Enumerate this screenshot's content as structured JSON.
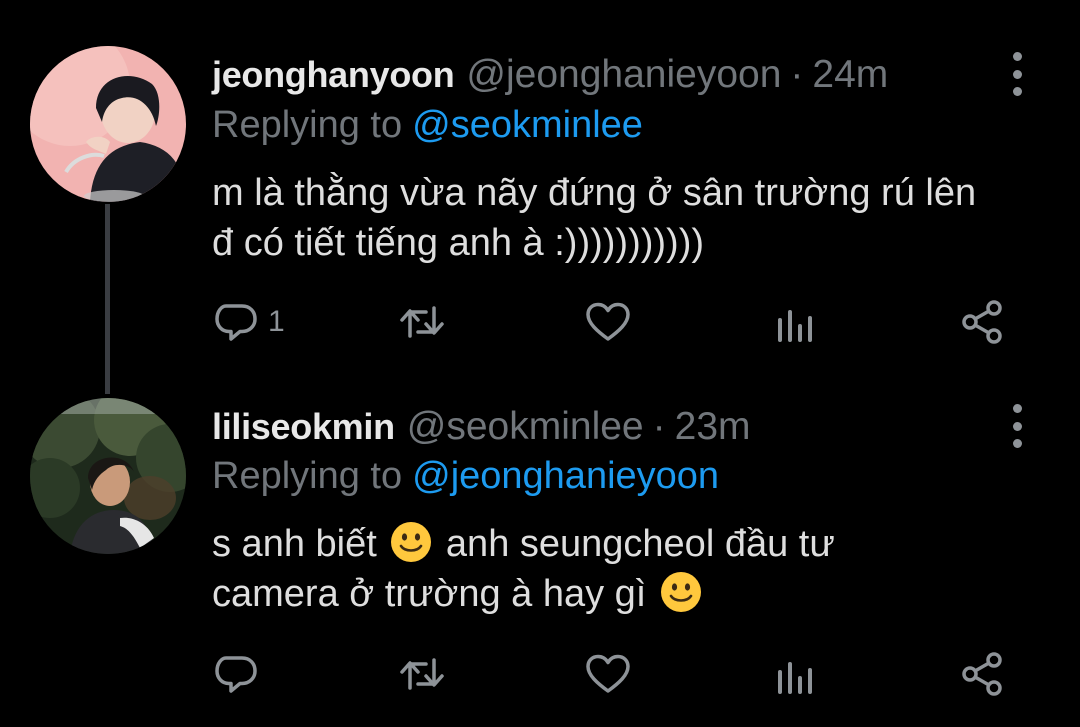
{
  "thread": [
    {
      "display_name": "jeonghanyoon",
      "handle": "@jeonghanieyoon",
      "separator": "·",
      "time": "24m",
      "replying_label": "Replying to",
      "replying_handle": "@seokminlee",
      "text_line_1": "m là thằng vừa nãy đứng ở sân trường rú lên",
      "text_line_2": "đ có tiết tiếng anh à :)))))))))))",
      "reply_count": "1",
      "avatar": "avatar-photo"
    },
    {
      "display_name": "liliseokmin",
      "handle": "@seokminlee",
      "separator": "·",
      "time": "23m",
      "replying_label": "Replying to",
      "replying_handle": "@jeonghanieyoon",
      "text_part_1": "s anh biết",
      "text_part_2": "anh seungcheol đầu tư",
      "text_part_3": "camera ở trường à hay gì",
      "reply_count": "",
      "avatar": "avatar-photo"
    }
  ],
  "icons": {
    "reply": "comment-bubble-icon",
    "retweet": "retweet-icon",
    "like": "heart-icon",
    "stats": "analytics-bars-icon",
    "share": "share-icon",
    "more": "vertical-dots-icon",
    "emoji": "slightly-smiling-face-emoji"
  },
  "colors": {
    "background": "#000000",
    "text": "#dedede",
    "muted": "#71767b",
    "accent": "#1d9bf0",
    "icon": "#8e9398",
    "thread_line": "#3a3d42"
  }
}
